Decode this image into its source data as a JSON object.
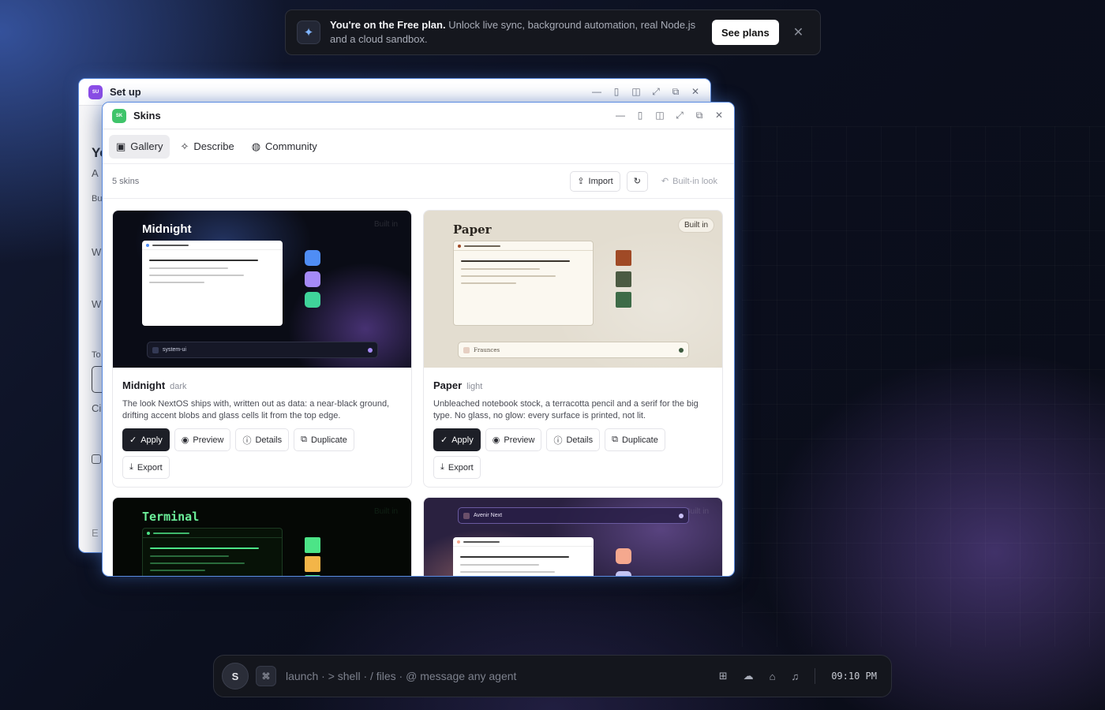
{
  "banner": {
    "lead": "You're on the Free plan.",
    "text": "Unlock live sync, background automation, real Node.js and a cloud sandbox.",
    "cta": "See plans",
    "close": "✕"
  },
  "back_window": {
    "title": "Set up",
    "badge": "SU",
    "fragments": [
      "Yo",
      "A",
      "Bu",
      "W",
      "W",
      "To",
      "Ci",
      "E"
    ]
  },
  "front_window": {
    "title": "Skins",
    "badge": "SK",
    "tabs": [
      {
        "label": "Gallery",
        "active": true
      },
      {
        "label": "Describe",
        "active": false
      },
      {
        "label": "Community",
        "active": false
      }
    ],
    "toolbar": {
      "count": "5 skins",
      "import": "Import",
      "builtin_look": "Built-in look"
    },
    "cards": [
      {
        "preview_title": "Midnight",
        "badge": "Built in",
        "dock_label": "system-ui",
        "name": "Midnight",
        "tag": "dark",
        "desc": "The look NextOS ships with, written out as data: a near-black ground, drifting accent blobs and glass cells lit from the top edge.",
        "actions": [
          "Apply",
          "Preview",
          "Details",
          "Duplicate",
          "Export"
        ]
      },
      {
        "preview_title": "Paper",
        "badge": "Built in",
        "dock_label": "Fraunces",
        "name": "Paper",
        "tag": "light",
        "desc": "Unbleached notebook stock, a terracotta pencil and a serif for the big type. No glass, no glow: every surface is printed, not lit.",
        "actions": [
          "Apply",
          "Preview",
          "Details",
          "Duplicate",
          "Export"
        ]
      },
      {
        "preview_title": "Terminal",
        "badge": "Built in"
      },
      {
        "preview_title": "",
        "badge": "Built in",
        "dock_label": "Avenir Next"
      }
    ]
  },
  "dock": {
    "avatar": "S",
    "cmd": "⌘",
    "placeholder": "launch · > shell · / files · @ message any agent",
    "clock": "09:10 PM"
  },
  "colors": {
    "accent_border": "#5a8be0",
    "midnight_swatches": [
      "#4f8df5",
      "#a58af7",
      "#3fd49a"
    ],
    "paper_swatches": [
      "#a04a26",
      "#4b5a42",
      "#3d6b47"
    ],
    "terminal_swatches": [
      "#4ce487",
      "#f3b548",
      "#4ce487"
    ],
    "aurora_swatches": [
      "#f5a88e",
      "#c4c4f3"
    ]
  }
}
